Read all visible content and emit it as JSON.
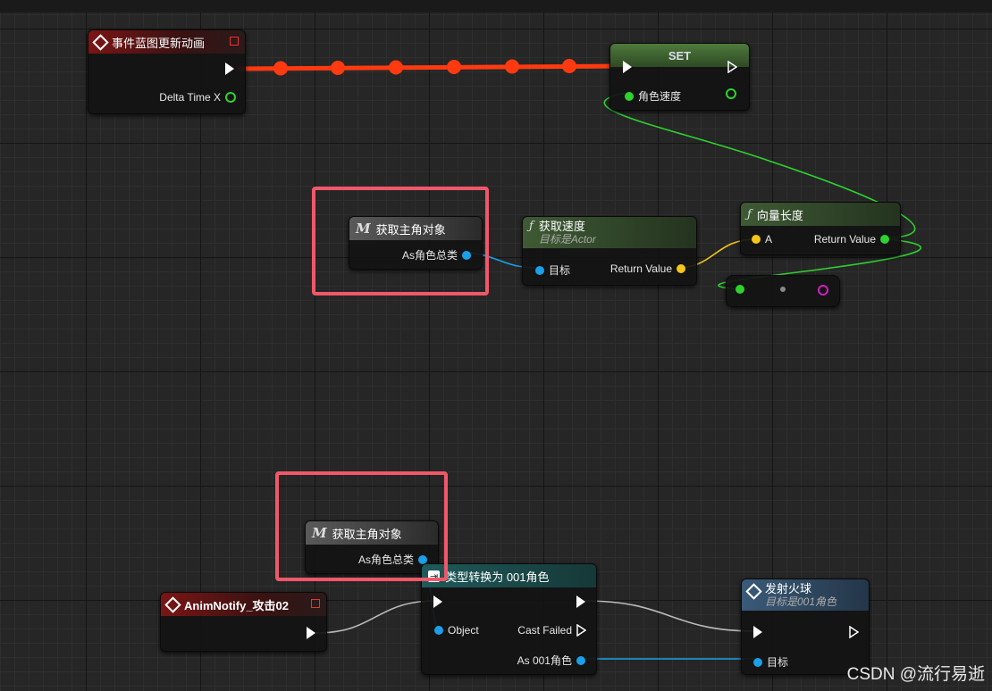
{
  "colors": {
    "exec": "#ffffff",
    "float": "#2ed22e",
    "vector": "#f5c518",
    "object": "#1aa0e8",
    "select_out": "#d020c0",
    "highlight": "#f0586a",
    "event_wire": "#ff3a10"
  },
  "nodes": {
    "event_update": {
      "title": "事件蓝图更新动画",
      "pin_delta": "Delta Time X",
      "icon": "event-diamond-icon"
    },
    "set_node": {
      "title": "SET",
      "pin_var": "角色速度"
    },
    "get_player_1": {
      "badge": "M",
      "title": "获取主角对象",
      "pin_out": "As角色总类"
    },
    "get_velocity": {
      "badge": "ƒ",
      "title": "获取速度",
      "subtitle": "目标是Actor",
      "pin_target": "目标",
      "pin_return": "Return Value"
    },
    "vector_length": {
      "badge": "ƒ",
      "title": "向量长度",
      "pin_a": "A",
      "pin_return": "Return Value"
    },
    "get_player_2": {
      "badge": "M",
      "title": "获取主角对象",
      "pin_out": "As角色总类"
    },
    "anim_notify": {
      "title": "AnimNotify_攻击02",
      "icon": "event-diamond-icon"
    },
    "cast_node": {
      "title": "类型转换为 001角色",
      "pin_object": "Object",
      "pin_cast_failed": "Cast Failed",
      "pin_as": "As 001角色"
    },
    "fire_ball": {
      "title": "发射火球",
      "subtitle": "目标是001角色",
      "pin_target": "目标"
    }
  },
  "watermark": "CSDN @流行易逝"
}
